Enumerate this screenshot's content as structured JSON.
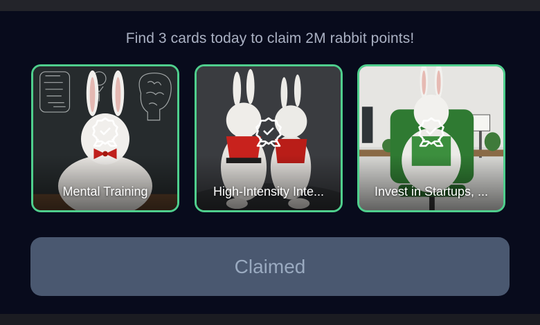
{
  "header": {
    "headline": "Find 3 cards today to claim 2M rabbit points!"
  },
  "cards": [
    {
      "title": "Mental Training",
      "badge_icon": "award-check-icon",
      "scene": "rabbit-chalkboard"
    },
    {
      "title": "High-Intensity Inte...",
      "badge_icon": "award-check-icon",
      "scene": "rabbits-karate"
    },
    {
      "title": "Invest in Startups, ...",
      "badge_icon": "award-check-icon",
      "scene": "rabbit-office-chair"
    }
  ],
  "claim_button": {
    "label": "Claimed",
    "state": "disabled"
  },
  "colors": {
    "background": "#080b1c",
    "card_border": "#4fcf8d",
    "button_bg": "#4a5870",
    "button_text": "#9aaac0",
    "headline_text": "#aab1c3"
  }
}
